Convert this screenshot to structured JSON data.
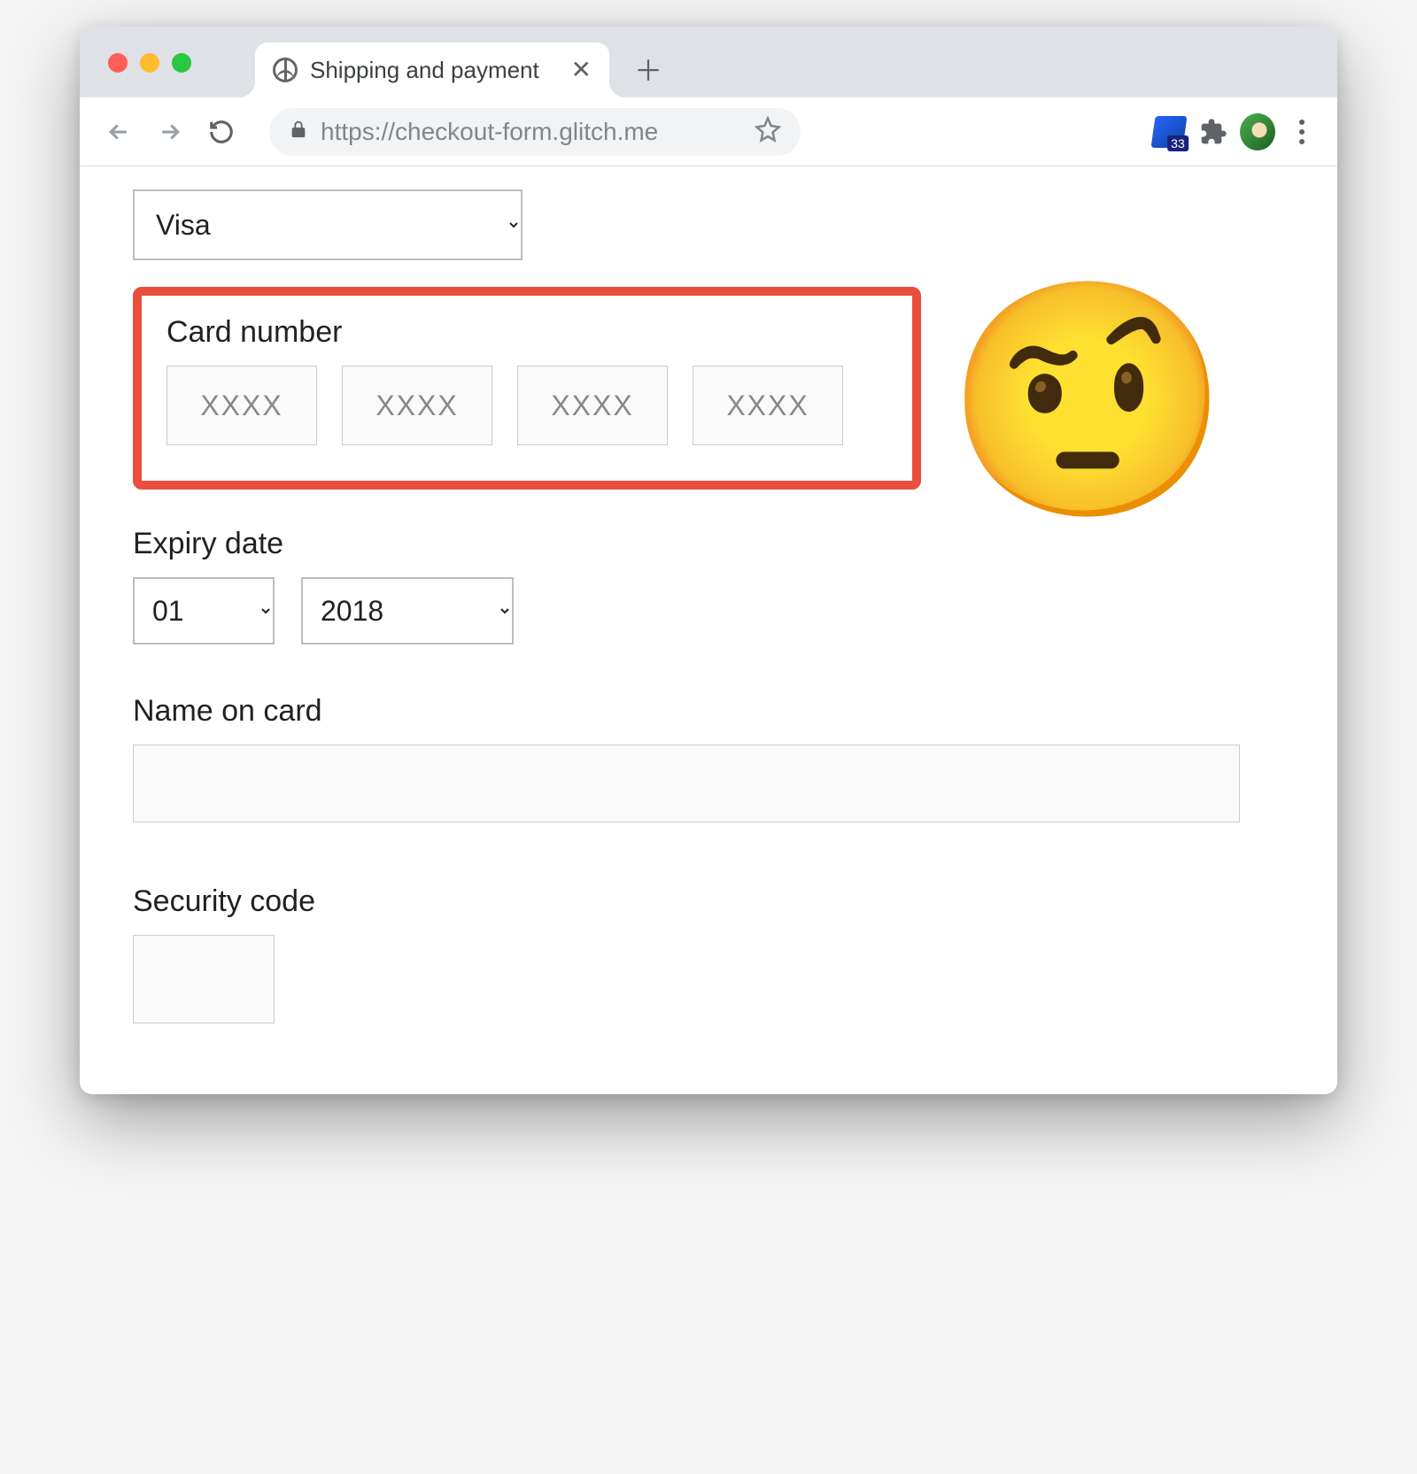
{
  "browser": {
    "tab_title": "Shipping and payment",
    "url": "https://checkout-form.glitch.me",
    "extension_badge_count": "33"
  },
  "form": {
    "card_type": {
      "selected": "Visa"
    },
    "card_number": {
      "label": "Card number",
      "placeholder": "XXXX"
    },
    "expiry": {
      "label": "Expiry date",
      "month": "01",
      "year": "2018"
    },
    "name_on_card": {
      "label": "Name on card",
      "value": ""
    },
    "security_code": {
      "label": "Security code",
      "value": ""
    }
  },
  "annotation": {
    "emoji": "🤨",
    "highlight_color": "#e84f3d"
  }
}
